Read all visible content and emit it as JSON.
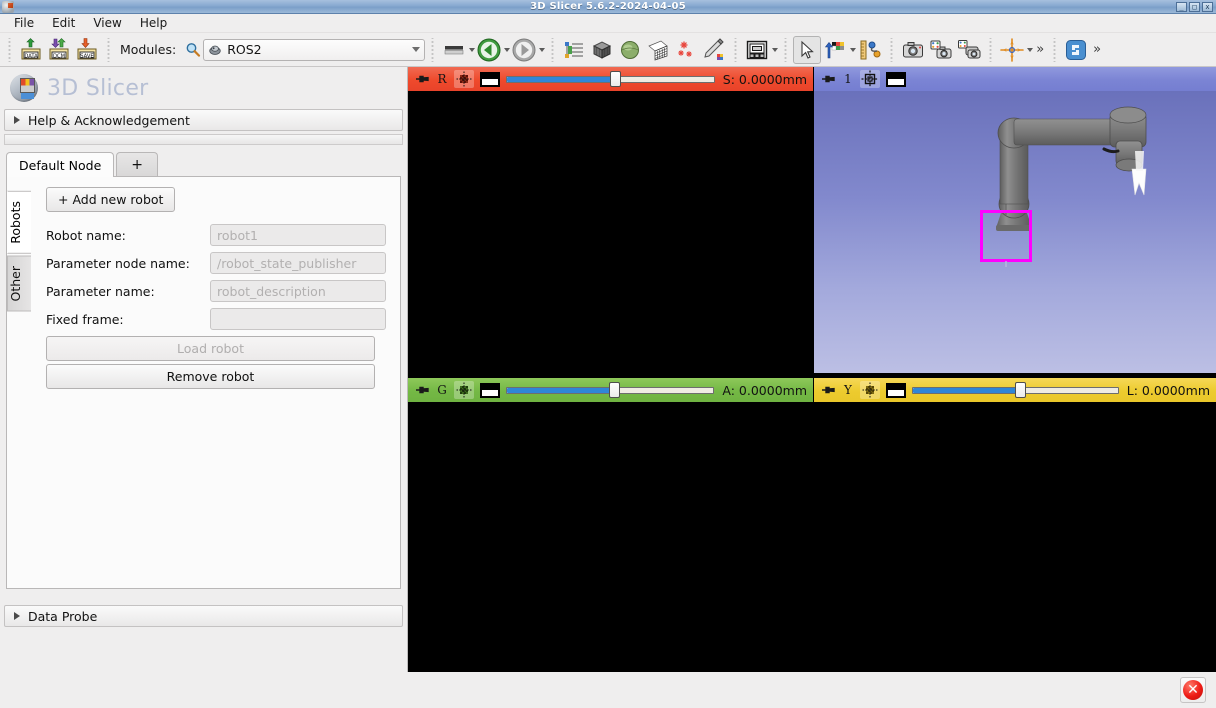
{
  "window": {
    "title": "3D Slicer 5.6.2-2024-04-05",
    "minimize": "_",
    "maximize": "□",
    "close": "x"
  },
  "menubar": {
    "items": [
      {
        "label": "File"
      },
      {
        "label": "Edit"
      },
      {
        "label": "View"
      },
      {
        "label": "Help"
      }
    ]
  },
  "toolbar": {
    "modules_label": "Modules:",
    "search_icon": "search-icon",
    "module_selected": "ROS2",
    "buttons": [
      {
        "name": "load-data-button",
        "icon": "data-icon",
        "text": "DATA"
      },
      {
        "name": "load-dicom-button",
        "icon": "dcm-icon",
        "text": "DCM"
      },
      {
        "name": "save-data-button",
        "icon": "save-icon",
        "text": "SAVE"
      },
      {
        "name": "favorite-modules-button",
        "icon": "modules-strip-icon"
      },
      {
        "name": "previous-module-button",
        "icon": "arrow-left-icon"
      },
      {
        "name": "next-module-button",
        "icon": "arrow-right-icon"
      },
      {
        "name": "subject-hierarchy-button",
        "icon": "tree-icon"
      },
      {
        "name": "volume-rendering-button",
        "icon": "cube-icon"
      },
      {
        "name": "models-button",
        "icon": "sphere-icon"
      },
      {
        "name": "volumes-button",
        "icon": "grid-plane-icon"
      },
      {
        "name": "segment-editor-button",
        "icon": "asterisks-icon"
      },
      {
        "name": "markups-button",
        "icon": "pencil-icon"
      },
      {
        "name": "layout-button",
        "icon": "layout-icon"
      },
      {
        "name": "mouse-mode-button",
        "icon": "cursor-icon"
      },
      {
        "name": "window-level-button",
        "icon": "window-level-icon"
      },
      {
        "name": "ruler-button",
        "icon": "ruler-icon"
      },
      {
        "name": "screenshot-button",
        "icon": "camera-icon"
      },
      {
        "name": "scene-views-button",
        "icon": "scene-camera-icon"
      },
      {
        "name": "capture-sequence-button",
        "icon": "capture-stack-icon"
      },
      {
        "name": "crosshair-button",
        "icon": "crosshair-icon"
      },
      {
        "name": "more-tools-button",
        "icon": "chevron-double-right-icon"
      },
      {
        "name": "python-console-button",
        "icon": "python-icon"
      },
      {
        "name": "toolbar-overflow-button",
        "icon": "chevron-double-right-icon"
      }
    ],
    "overflow_glyph": "»"
  },
  "panel": {
    "brand": "3D Slicer",
    "help_section": "Help & Acknowledgement",
    "data_probe": "Data Probe",
    "node_tabs": [
      {
        "label": "Default Node",
        "active": true
      },
      {
        "label": "+",
        "active": false
      }
    ],
    "vertical_tabs": [
      {
        "label": "Robots",
        "active": true
      },
      {
        "label": "Other",
        "active": false
      }
    ],
    "form": {
      "add_robot_button": "+ Add new robot",
      "fields": [
        {
          "label": "Robot name:",
          "placeholder": "robot1",
          "value": ""
        },
        {
          "label": "Parameter node name:",
          "placeholder": "/robot_state_publisher",
          "value": ""
        },
        {
          "label": "Parameter name:",
          "placeholder": "robot_description",
          "value": ""
        },
        {
          "label": "Fixed frame:",
          "placeholder": "",
          "value": ""
        }
      ],
      "load_robot_button": "Load robot",
      "remove_robot_button": "Remove robot"
    }
  },
  "views": {
    "red": {
      "name": "Red slice view",
      "letter": "R",
      "value": "S: 0.0000mm",
      "slider_percent": 52,
      "color": "#ef4a2c"
    },
    "green": {
      "name": "Green slice view",
      "letter": "G",
      "value": "A: 0.0000mm",
      "slider_percent": 52,
      "color": "#74b845"
    },
    "yellow": {
      "name": "Yellow slice view",
      "letter": "Y",
      "value": "L: 0.0000mm",
      "slider_percent": 52,
      "color": "#edcb2e"
    },
    "threed": {
      "name": "3D view",
      "letter": "1",
      "color": "#7b84d4",
      "background_top": "#6a71bb",
      "background_bottom": "#bcbfe4",
      "selection_box_color": "#ff00ff"
    }
  },
  "statusbar": {
    "error_icon": "error-circle-icon",
    "error_glyph": "✕"
  }
}
